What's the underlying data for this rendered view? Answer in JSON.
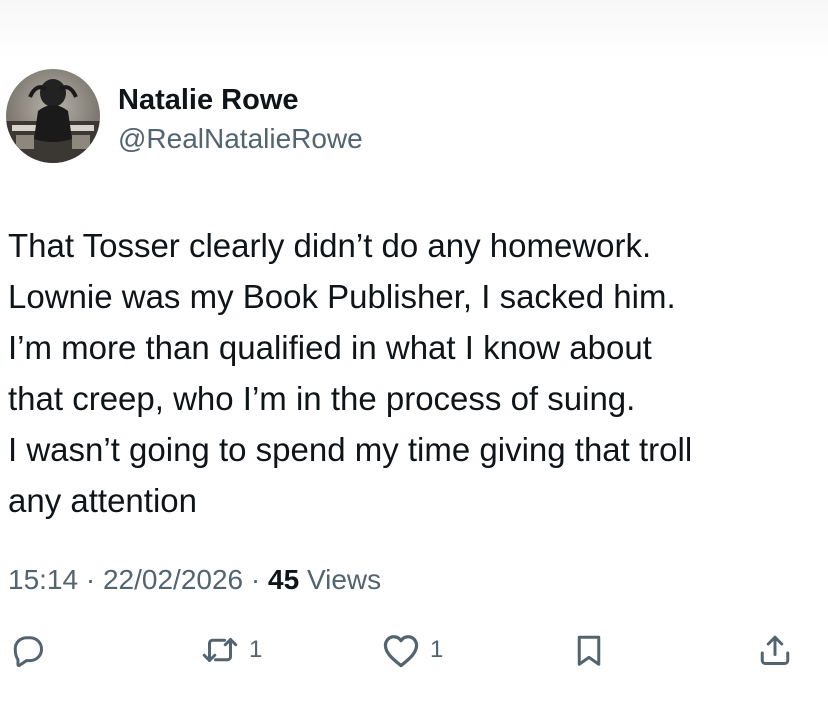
{
  "author": {
    "display_name": "Natalie Rowe",
    "handle": "@RealNatalieRowe"
  },
  "tweet": {
    "text": "That Tosser clearly didn’t do any homework.\nLownie was my Book Publisher, I sacked him.\nI’m more than qualified in what I know about\nthat creep, who I’m in the process of suing.\nI wasn’t going to spend my time giving that troll\nany attention",
    "time": "15:14",
    "date": "22/02/2026",
    "separator": "·",
    "views_count": "45",
    "views_label": "Views"
  },
  "actions": {
    "reply_icon": "reply-icon",
    "retweet_icon": "retweet-icon",
    "retweet_count": "1",
    "like_icon": "heart-icon",
    "like_count": "1",
    "bookmark_icon": "bookmark-icon",
    "share_icon": "share-icon"
  },
  "colors": {
    "text": "#0f1419",
    "secondary": "#536471",
    "background": "#ffffff"
  }
}
